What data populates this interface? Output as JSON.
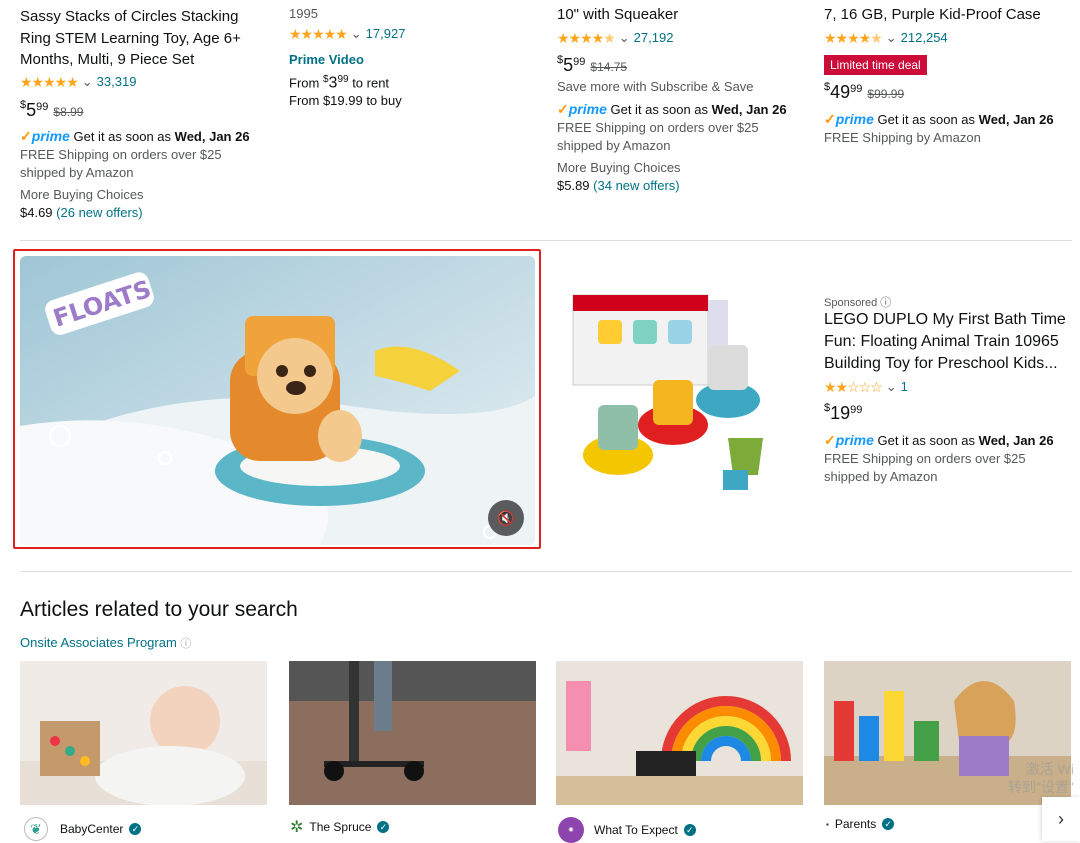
{
  "products": [
    {
      "title": "Sassy Stacks of Circles Stacking Ring STEM Learning Toy, Age 6+ Months, Multi, 9 Piece Set",
      "rating_count": "33,319",
      "price_dollars": "5",
      "price_cents": "99",
      "list_price": "$8.99",
      "prime_label": "prime",
      "delivery_prefix": "Get it as soon as",
      "delivery_date": "Wed, Jan 26",
      "shipping": "FREE Shipping on orders over $25 shipped by Amazon",
      "more_buying": "More Buying Choices",
      "offer_price": "$4.69",
      "offers": "(26 new offers)"
    },
    {
      "title_partial": "1995",
      "rating_count": "17,927",
      "format": "Prime Video",
      "rent_prefix": "From",
      "rent_dollars": "3",
      "rent_cents": "99",
      "rent_suffix": "to rent",
      "buy": "From $19.99 to buy"
    },
    {
      "title_partial": "10\" with Squeaker",
      "rating_count": "27,192",
      "price_dollars": "5",
      "price_cents": "99",
      "list_price": "$14.75",
      "subscribe": "Save more with Subscribe & Save",
      "prime_label": "prime",
      "delivery_prefix": "Get it as soon as",
      "delivery_date": "Wed, Jan 26",
      "shipping": "FREE Shipping on orders over $25 shipped by Amazon",
      "more_buying": "More Buying Choices",
      "offer_price": "$5.89",
      "offers": "(34 new offers)"
    },
    {
      "title_partial": "7, 16 GB, Purple Kid-Proof Case",
      "rating_count": "212,254",
      "deal_badge": "Limited time deal",
      "price_dollars": "49",
      "price_cents": "99",
      "list_price": "$99.99",
      "prime_label": "prime",
      "delivery_prefix": "Get it as soon as",
      "delivery_date": "Wed, Jan 26",
      "shipping": "FREE Shipping by Amazon"
    }
  ],
  "video": {
    "overlay_text": "FLOATS"
  },
  "sponsored": {
    "label": "Sponsored",
    "title": "LEGO DUPLO My First Bath Time Fun: Floating Animal Train 10965 Building Toy for Preschool Kids...",
    "rating_count": "1",
    "price_dollars": "19",
    "price_cents": "99",
    "prime_label": "prime",
    "delivery_prefix": "Get it as soon as",
    "delivery_date": "Wed, Jan 26",
    "shipping": "FREE Shipping on orders over $25 shipped by Amazon"
  },
  "articles": {
    "heading": "Articles related to your search",
    "program_link": "Onsite Associates Program",
    "sources": [
      "BabyCenter",
      "The Spruce",
      "What To Expect",
      "Parents"
    ]
  },
  "watermark": {
    "line1": "激活 Wi",
    "line2": "转到\"设置\""
  },
  "colors": {
    "accent_link": "#007185",
    "star": "#FFA41C",
    "prime_blue": "#1399FF",
    "deal_red": "#CC0C39",
    "video_outline": "#E02020"
  }
}
